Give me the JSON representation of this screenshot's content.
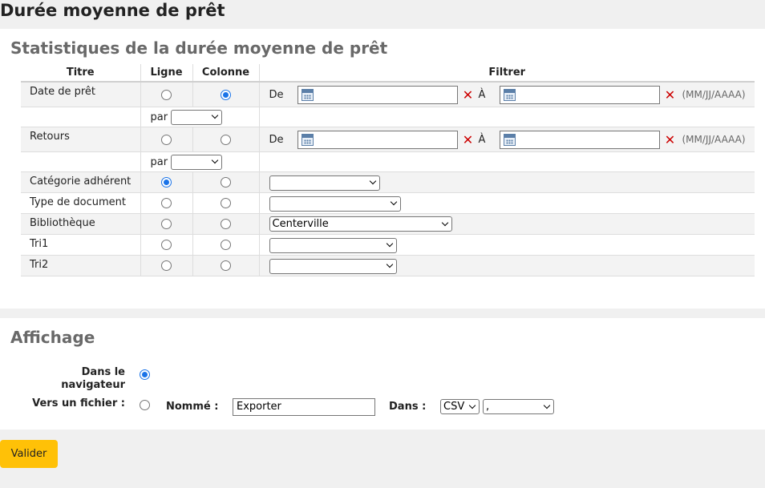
{
  "page_title": "Durée moyenne de prêt",
  "stats": {
    "heading": "Statistiques de la durée moyenne de prêt",
    "headers": {
      "title": "Titre",
      "line": "Ligne",
      "column": "Colonne",
      "filter": "Filtrer"
    },
    "date_from": "De",
    "date_to": "À",
    "date_format": "(MM/JJ/AAAA)",
    "par": "par",
    "rows": {
      "issuedate": "Date de prêt",
      "returndate": "Retours",
      "borrower_category": "Catégorie adhérent",
      "item_type": "Type de document",
      "library": "Bibliothèque",
      "sort1": "Tri1",
      "sort2": "Tri2"
    },
    "library_selected": "Centerville"
  },
  "display": {
    "heading": "Affichage",
    "browser_label": "Dans le navigateur",
    "file_label": "Vers un fichier :",
    "named_label": "Nommé :",
    "filename": "Exporter",
    "in_label": "Dans :",
    "format": "CSV",
    "separator": ","
  },
  "submit_label": "Valider"
}
